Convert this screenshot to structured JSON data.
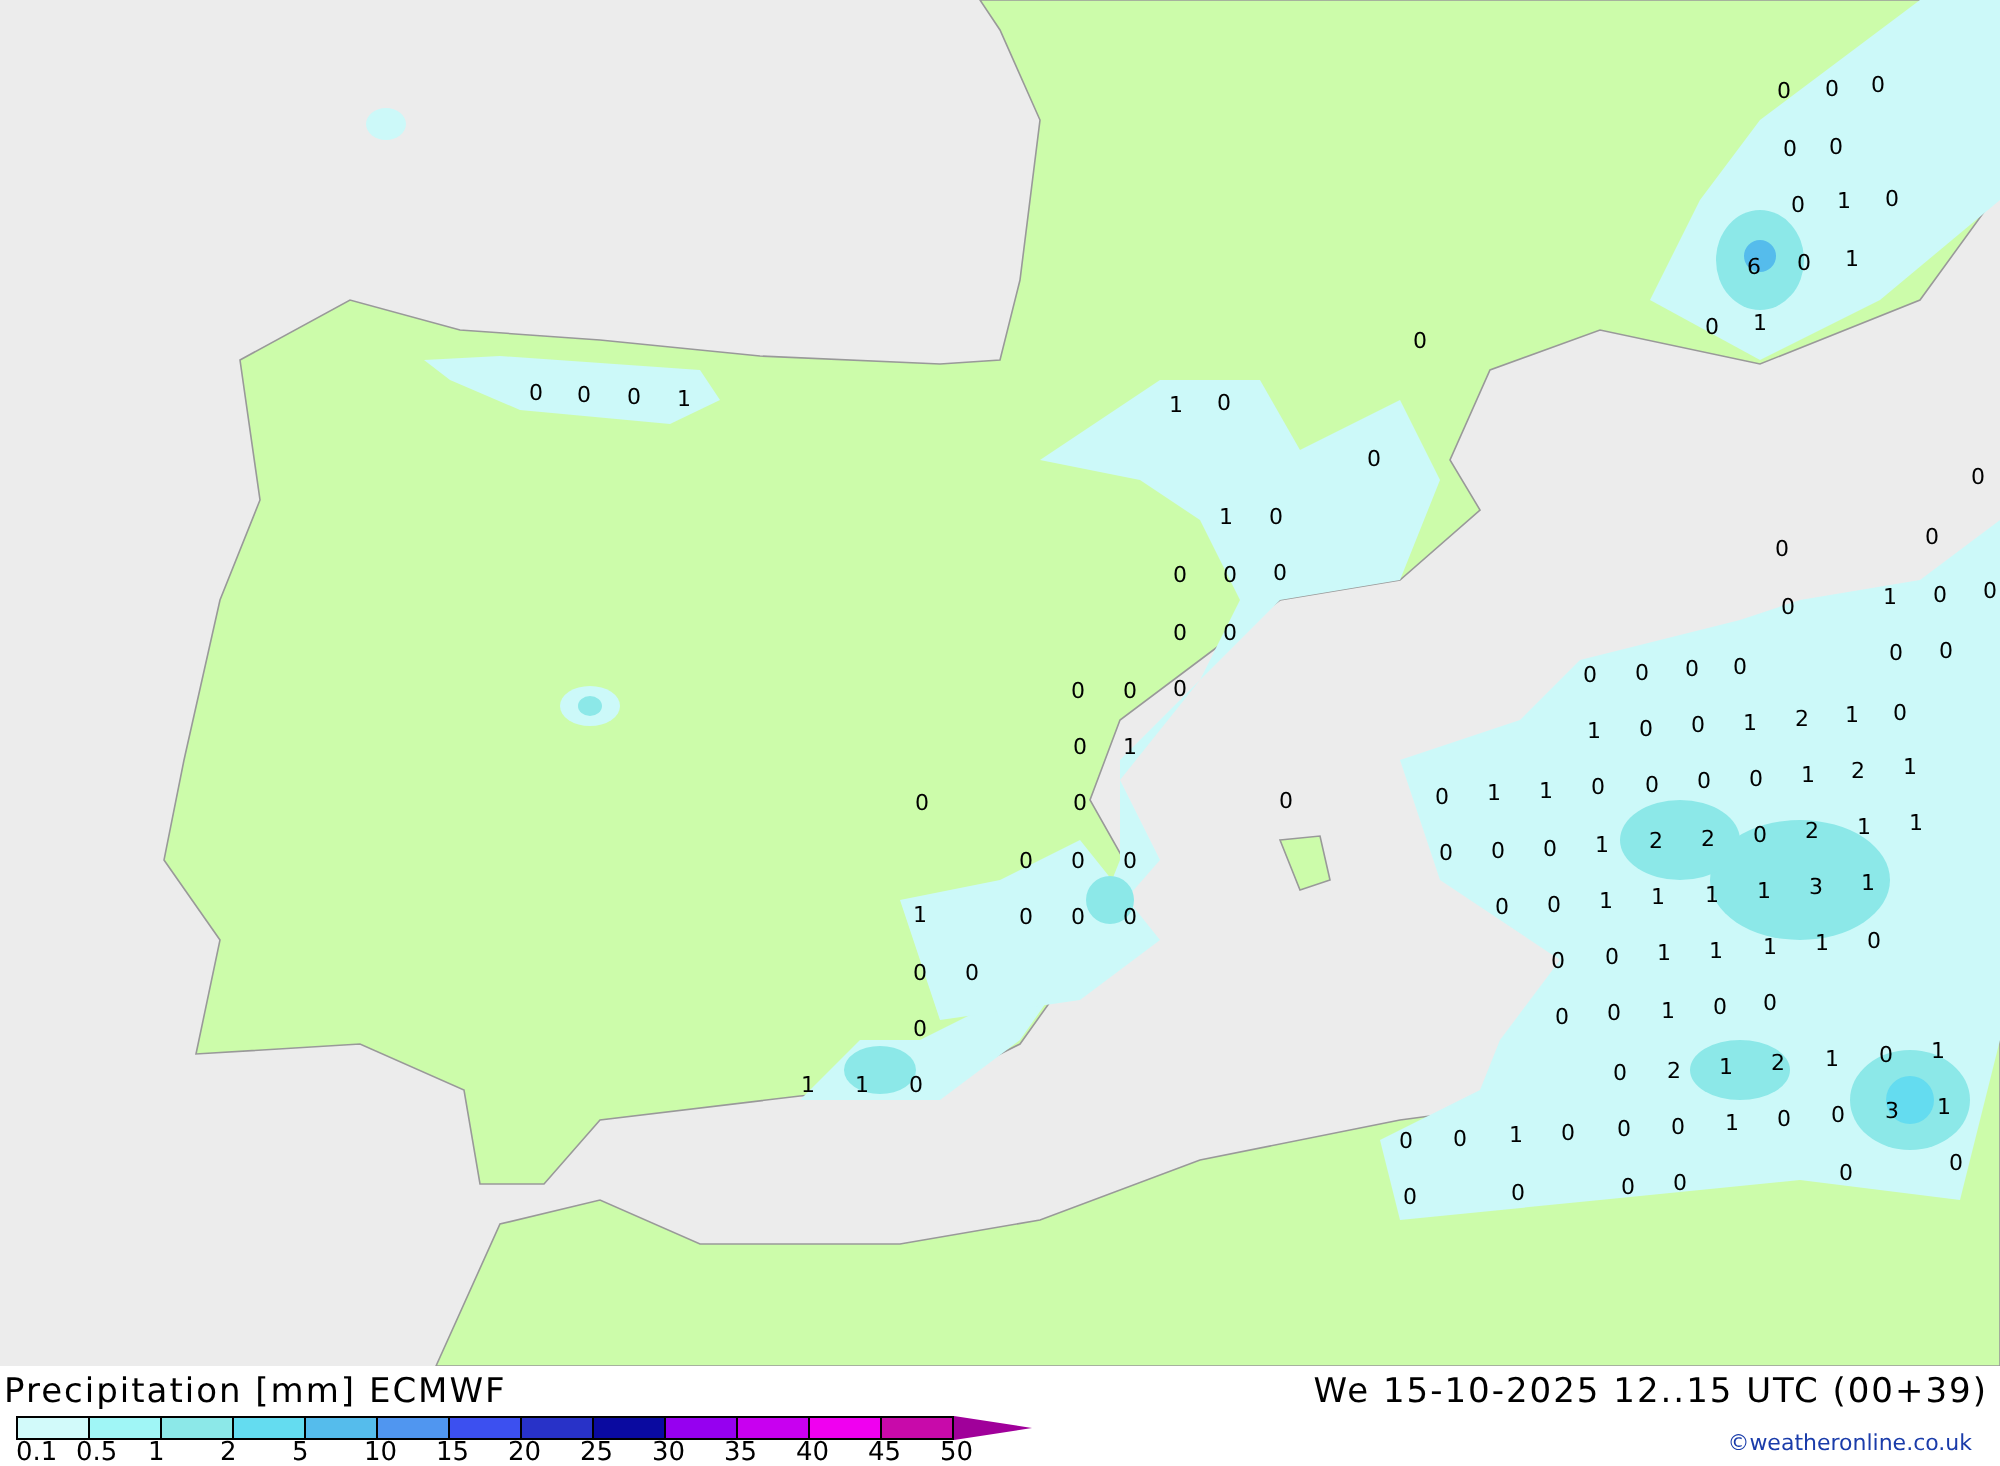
{
  "map": {
    "precipitation_values": [
      "0",
      "0",
      "0",
      "0",
      "0",
      "0",
      "1",
      "0",
      "6",
      "0",
      "1",
      "0",
      "0",
      "1",
      "0",
      "0",
      "0",
      "1",
      "1",
      "0",
      "0",
      "0",
      "1",
      "0",
      "0",
      "0",
      "0",
      "0",
      "0",
      "0",
      "1",
      "0",
      "0",
      "0",
      "0",
      "0",
      "0",
      "0",
      "0",
      "0",
      "0",
      "0",
      "0",
      "0",
      "1",
      "0",
      "0",
      "1",
      "2",
      "1",
      "0",
      "0",
      "1",
      "0",
      "0",
      "0",
      "0",
      "1",
      "1",
      "0",
      "0",
      "0",
      "0",
      "1",
      "2",
      "1",
      "0",
      "0",
      "0",
      "0",
      "0",
      "0",
      "1",
      "2",
      "2",
      "0",
      "2",
      "1",
      "1",
      "1",
      "0",
      "0",
      "0",
      "0",
      "0",
      "1",
      "1",
      "1",
      "1",
      "3",
      "1",
      "0",
      "0",
      "0",
      "0",
      "1",
      "1",
      "1",
      "1",
      "0",
      "0",
      "0",
      "0",
      "1",
      "0",
      "0",
      "1",
      "1",
      "0",
      "0",
      "2",
      "1",
      "2",
      "1",
      "0",
      "1",
      "0",
      "0",
      "1",
      "0",
      "0",
      "0",
      "1",
      "0",
      "0",
      "3",
      "1",
      "0",
      "0",
      "0",
      "0",
      "0",
      "0"
    ]
  },
  "legend": {
    "title": "Precipitation [mm] ECMWF",
    "segments": [
      {
        "color": "#d2fafa"
      },
      {
        "color": "#a0f6f6"
      },
      {
        "color": "#8ce8e8"
      },
      {
        "color": "#64dcf0"
      },
      {
        "color": "#55bcec"
      },
      {
        "color": "#5096f0"
      },
      {
        "color": "#3c50f0"
      },
      {
        "color": "#2832c8"
      },
      {
        "color": "#0a0aa0"
      },
      {
        "color": "#9600f0"
      },
      {
        "color": "#c800f0"
      },
      {
        "color": "#f000f0"
      },
      {
        "color": "#c80aaa"
      }
    ],
    "ticks": [
      "0.1",
      "0.5",
      "1",
      "2",
      "5",
      "10",
      "15",
      "20",
      "25",
      "30",
      "35",
      "40",
      "45",
      "50"
    ]
  },
  "valid_time": "We 15-10-2025 12..15 UTC (00+39)",
  "credit": "©weatheronline.co.uk"
}
